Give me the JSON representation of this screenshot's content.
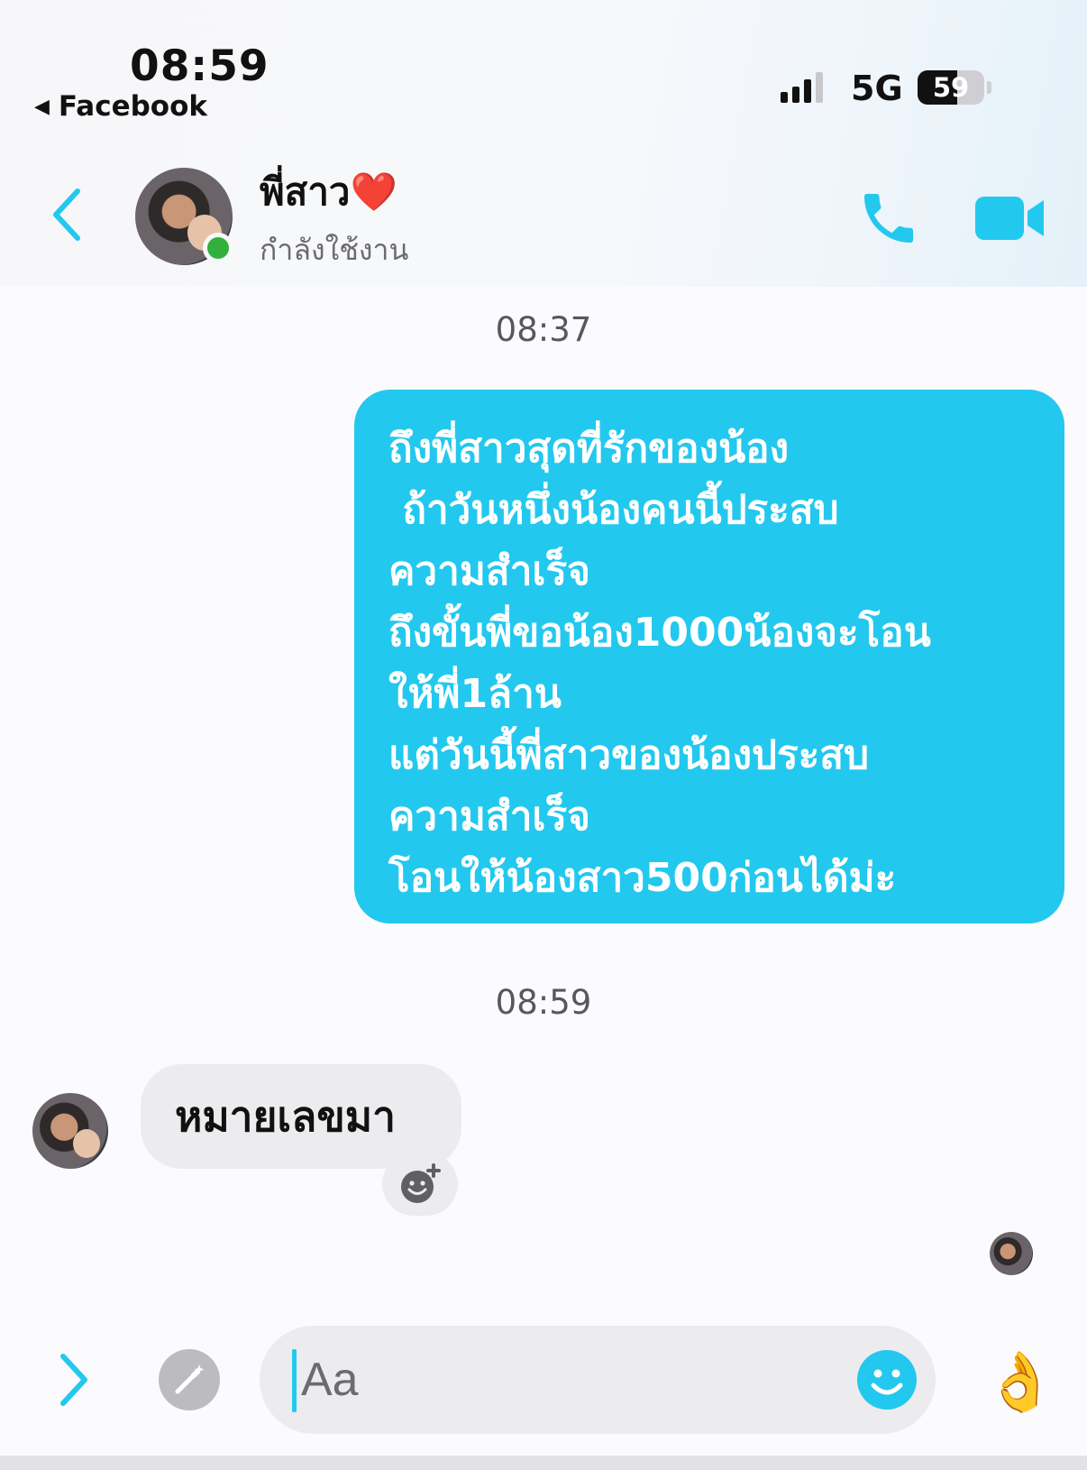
{
  "status_bar": {
    "time": "08:59",
    "back_app": "Facebook",
    "network": "5G",
    "battery": "59",
    "battery_level": 0.59
  },
  "header": {
    "contact_name": "พี่สาว❤️",
    "contact_status": "กำลังใช้งาน",
    "icons": [
      "back-chevron-icon",
      "phone-icon",
      "video-camera-icon"
    ]
  },
  "messages": [
    {
      "timestamp": "08:37",
      "direction": "outgoing",
      "lines": [
        "ถึงพี่สาวสุดที่รักของน้อง",
        " ถ้าวันหนึ่งน้องคนนี้ประสบ",
        "ความสำเร็จ",
        "ถึงขั้นพี่ขอน้อง1000น้องจะโอน",
        "ให้พี่1ล้าน",
        "แต่วันนี้พี่สาวของน้องประสบ",
        "ความสำเร็จ",
        "โอนให้น้องสาว500ก่อนได้ม่ะ"
      ]
    },
    {
      "timestamp": "08:59",
      "direction": "incoming",
      "text": "หมายเลขมา"
    }
  ],
  "composer": {
    "placeholder": "Aa",
    "quick_reaction": "👌"
  },
  "colors": {
    "accent": "#23c8ee",
    "online": "#31b13c",
    "incoming_bubble": "#ececef"
  }
}
